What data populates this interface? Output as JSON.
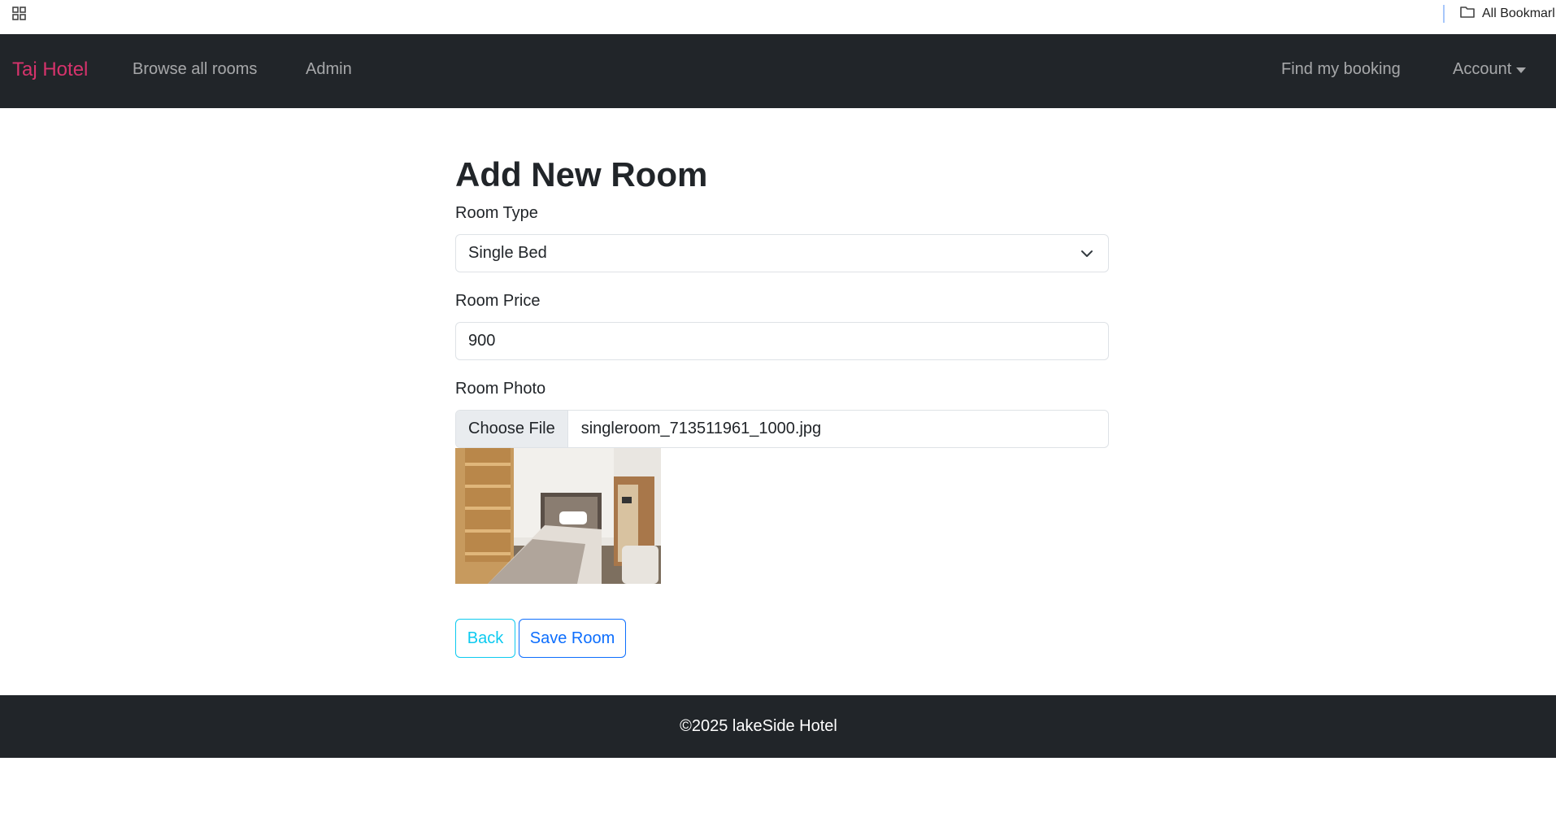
{
  "browser": {
    "all_bookmarks_label": "All Bookmarl"
  },
  "navbar": {
    "brand": "Taj Hotel",
    "links": {
      "browse": "Browse all rooms",
      "admin": "Admin",
      "find_booking": "Find my booking",
      "account": "Account"
    }
  },
  "form": {
    "title": "Add New Room",
    "room_type": {
      "label": "Room Type",
      "selected": "Single Bed"
    },
    "room_price": {
      "label": "Room Price",
      "value": "900"
    },
    "room_photo": {
      "label": "Room Photo",
      "button": "Choose File",
      "file_name": "singleroom_713511961_1000.jpg"
    },
    "buttons": {
      "back": "Back",
      "save": "Save Room"
    }
  },
  "footer": {
    "text": "©2025 lakeSide Hotel"
  },
  "colors": {
    "brand": "#d6336c",
    "navbar_bg": "#212529",
    "back_button": "#0dcaf0",
    "save_button": "#0d6efd"
  },
  "icons": [
    "apps-grid-icon",
    "folder-icon",
    "caret-down-icon",
    "chevron-down-icon"
  ]
}
